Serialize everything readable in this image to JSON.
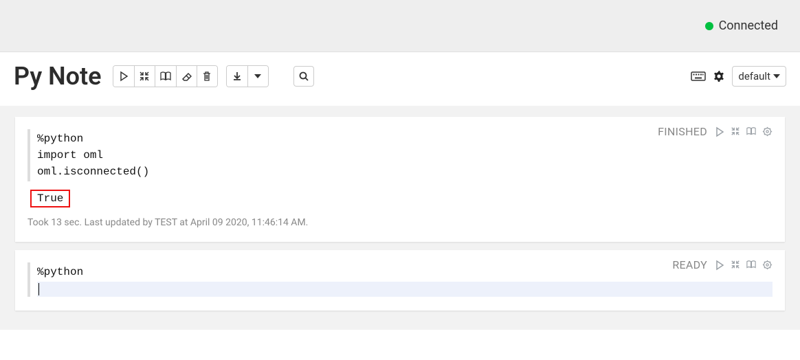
{
  "connection": {
    "status_label": "Connected",
    "color": "#00c040"
  },
  "title": "Py Note",
  "kernel": {
    "selected": "default"
  },
  "cells": [
    {
      "status": "FINISHED",
      "code": "%python\nimport oml\noml.isconnected()",
      "output": "True",
      "meta": "Took 13 sec. Last updated by TEST at April 09 2020, 11:46:14 AM."
    },
    {
      "status": "READY",
      "interpreter": "%python",
      "code": ""
    }
  ]
}
